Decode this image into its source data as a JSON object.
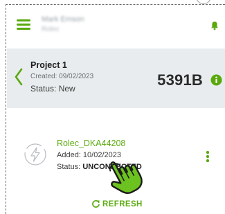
{
  "header": {
    "user_name": "Mark Emson",
    "user_company": "Rolec"
  },
  "project": {
    "title": "Project 1",
    "created": "Created: 09/02/2023",
    "status_label": "Status:",
    "status_value": "New",
    "balance": "5391B"
  },
  "device": {
    "name": "Rolec_DKA44208",
    "added": "Added: 10/02/2023",
    "status_label": "Status:",
    "status_value": "UNCONNECTED"
  },
  "actions": {
    "refresh_label": "REFRESH"
  },
  "colors": {
    "accent_green": "#5cab10",
    "panel_grey": "#e8ecee"
  },
  "icons": {
    "menu": "hamburger-icon",
    "notifications": "bell-icon",
    "back": "chevron-left-icon",
    "info": "info-icon",
    "device": "charger-bolt-icon",
    "more": "kebab-icon",
    "refresh": "refresh-icon",
    "pointer": "tap-hand-icon"
  }
}
